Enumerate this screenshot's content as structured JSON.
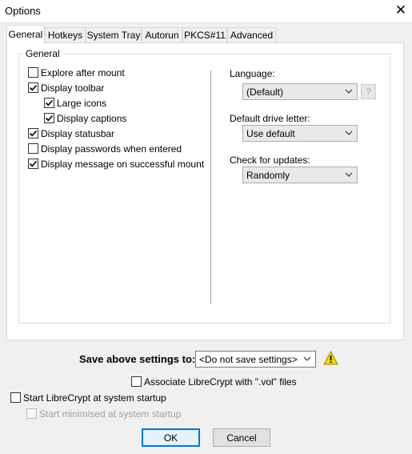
{
  "window": {
    "title": "Options"
  },
  "tabs": [
    {
      "label": "General",
      "active": true
    },
    {
      "label": "Hotkeys"
    },
    {
      "label": "System Tray"
    },
    {
      "label": "Autorun"
    },
    {
      "label": "PKCS#11"
    },
    {
      "label": "Advanced"
    }
  ],
  "general_group": {
    "title": "General",
    "options": [
      {
        "label": "Explore after mount",
        "checked": false
      },
      {
        "label": "Display toolbar",
        "checked": true
      },
      {
        "label": "Large icons",
        "checked": true
      },
      {
        "label": "Display captions",
        "checked": true
      },
      {
        "label": "Display statusbar",
        "checked": true
      },
      {
        "label": "Display passwords when entered",
        "checked": false
      },
      {
        "label": "Display message on successful mount",
        "checked": true
      }
    ],
    "language": {
      "label": "Language:",
      "value": "(Default)",
      "help": "?"
    },
    "drive_letter": {
      "label": "Default drive letter:",
      "value": "Use default"
    },
    "updates": {
      "label": "Check for updates:",
      "value": "Randomly"
    }
  },
  "save_settings": {
    "label": "Save above settings to:",
    "value": "<Do not save settings>",
    "warning_icon": "warning-icon"
  },
  "associate": {
    "label": "Associate LibreCrypt with \".vol\" files",
    "checked": false
  },
  "startup": {
    "label": "Start LibreCrypt at system startup",
    "checked": false
  },
  "minimised": {
    "label": "Start minimised at system startup",
    "checked": false,
    "disabled": true
  },
  "buttons": {
    "ok": "OK",
    "cancel": "Cancel"
  },
  "colors": {
    "accent": "#0078d7",
    "warning": "#f5d800"
  }
}
